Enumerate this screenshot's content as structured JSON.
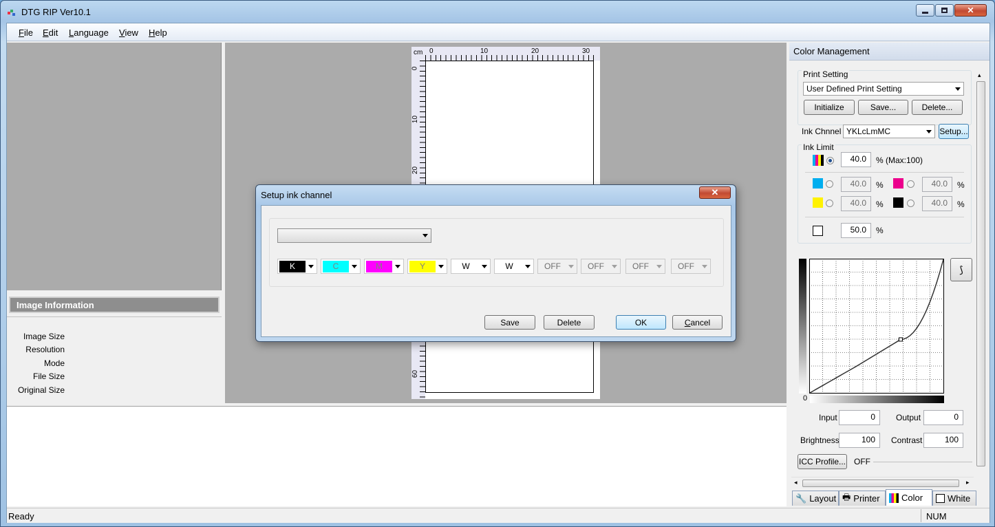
{
  "app": {
    "title": "DTG RIP Ver10.1"
  },
  "menu": [
    {
      "label": "File",
      "accel": "F",
      "rest": "ile"
    },
    {
      "label": "Edit",
      "accel": "E",
      "rest": "dit"
    },
    {
      "label": "Language",
      "accel": "L",
      "rest": "anguage"
    },
    {
      "label": "View",
      "accel": "V",
      "rest": "iew"
    },
    {
      "label": "Help",
      "accel": "H",
      "rest": "elp"
    }
  ],
  "image_info": {
    "header": "Image Information",
    "labels": [
      "Image Size",
      "Resolution",
      "Mode",
      "File Size",
      "Original Size"
    ]
  },
  "ruler": {
    "unit": "cm",
    "h_ticks": [
      "0",
      "10",
      "20",
      "30"
    ],
    "v_ticks": [
      "0",
      "10",
      "20",
      "60"
    ]
  },
  "status": {
    "text": "Ready",
    "num": "NUM"
  },
  "color_mgmt": {
    "title": "Color Management",
    "print_setting_label": "Print Setting",
    "print_setting_value": "User Defined Print Setting",
    "initialize": "Initialize",
    "save": "Save...",
    "delete": "Delete...",
    "ink_channel_label": "Ink Chnnel",
    "ink_channel_value": "YKLcLmMC",
    "setup": "Setup...",
    "ink_limit_label": "Ink Limit",
    "total_value": "40.0",
    "total_suffix": "% (Max:100)",
    "cyan_value": "40.0",
    "magenta_value": "40.0",
    "yellow_value": "40.0",
    "black_value": "40.0",
    "white_value": "50.0",
    "percent": "%",
    "curve_zero": "0",
    "input_label": "Input",
    "input_value": "0",
    "output_label": "Output",
    "output_value": "0",
    "brightness_label": "Brightness",
    "brightness_value": "100",
    "contrast_label": "Contrast",
    "contrast_value": "100",
    "icc_button": "ICC Profile...",
    "icc_state": "OFF",
    "curve_points": [
      [
        0,
        0
      ],
      [
        0.35,
        0.2
      ],
      [
        0.68,
        0.4
      ],
      [
        1,
        1
      ]
    ],
    "colors": {
      "cyan": "#00aeef",
      "magenta": "#ec008c",
      "yellow": "#fff200",
      "black": "#000000"
    }
  },
  "tabs": [
    {
      "label": "Layout",
      "icon": "layout-icon"
    },
    {
      "label": "Printer",
      "icon": "printer-icon"
    },
    {
      "label": "Color",
      "icon": "color-icon"
    },
    {
      "label": "White",
      "icon": "white-icon"
    }
  ],
  "dialog": {
    "title": "Setup ink channel",
    "preset_value": "",
    "channels": [
      {
        "label": "K",
        "bg": "#000000",
        "fg": "#ffffff",
        "off": false
      },
      {
        "label": "C",
        "bg": "#00ffff",
        "fg": "#808080",
        "off": false
      },
      {
        "label": "M",
        "bg": "#ff00ff",
        "fg": "#808080",
        "off": false
      },
      {
        "label": "Y",
        "bg": "#ffff00",
        "fg": "#808080",
        "off": false
      },
      {
        "label": "W",
        "bg": "#ffffff",
        "fg": "#000000",
        "off": false
      },
      {
        "label": "W",
        "bg": "#ffffff",
        "fg": "#000000",
        "off": false
      },
      {
        "label": "OFF",
        "bg": "#f0f0f0",
        "fg": "#6d6d6d",
        "off": true
      },
      {
        "label": "OFF",
        "bg": "#f0f0f0",
        "fg": "#6d6d6d",
        "off": true
      },
      {
        "label": "OFF",
        "bg": "#f0f0f0",
        "fg": "#6d6d6d",
        "off": true
      },
      {
        "label": "OFF",
        "bg": "#f0f0f0",
        "fg": "#6d6d6d",
        "off": true
      }
    ],
    "save": "Save",
    "delete": "Delete",
    "ok": "OK",
    "cancel": "Cancel",
    "cancel_accel": "C",
    "cancel_rest": "ancel",
    "close": "x"
  }
}
